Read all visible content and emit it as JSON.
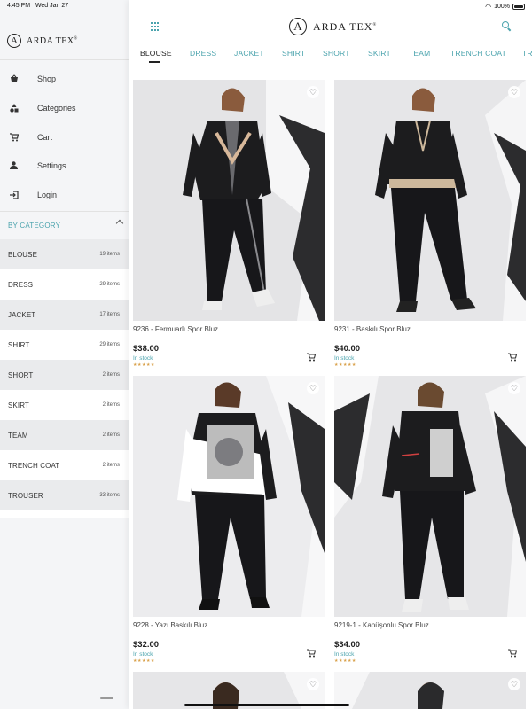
{
  "status_bar": {
    "time": "4:45 PM",
    "date": "Wed Jan 27",
    "battery": "100%"
  },
  "brand": {
    "letter": "A",
    "name": "ARDA TEX",
    "reg": "®"
  },
  "sidebar": {
    "nav": [
      {
        "label": "Shop",
        "icon": "basket-icon"
      },
      {
        "label": "Categories",
        "icon": "shapes-icon"
      },
      {
        "label": "Cart",
        "icon": "cart-icon"
      },
      {
        "label": "Settings",
        "icon": "person-icon"
      },
      {
        "label": "Login",
        "icon": "login-icon"
      }
    ],
    "category_header": "BY CATEGORY",
    "categories": [
      {
        "name": "BLOUSE",
        "count": "19 items"
      },
      {
        "name": "DRESS",
        "count": "29 items"
      },
      {
        "name": "JACKET",
        "count": "17 items"
      },
      {
        "name": "SHIRT",
        "count": "29 items"
      },
      {
        "name": "SHORT",
        "count": "2 items"
      },
      {
        "name": "SKIRT",
        "count": "2 items"
      },
      {
        "name": "TEAM",
        "count": "2 items"
      },
      {
        "name": "TRENCH COAT",
        "count": "2 items"
      },
      {
        "name": "TROUSER",
        "count": "33 items"
      }
    ]
  },
  "tabs": [
    "BLOUSE",
    "DRESS",
    "JACKET",
    "SHIRT",
    "SHORT",
    "SKIRT",
    "TEAM",
    "TRENCH COAT",
    "TR"
  ],
  "active_tab": "BLOUSE",
  "products": [
    {
      "name": "9236 - Fermuarlı Spor Bluz",
      "price": "$38.00",
      "stock": "In stock",
      "stars": "★★★★★"
    },
    {
      "name": "9231 - Baskılı Spor Bluz",
      "price": "$40.00",
      "stock": "In stock",
      "stars": "★★★★★"
    },
    {
      "name": "9228 - Yazı Baskılı Bluz",
      "price": "$32.00",
      "stock": "In stock",
      "stars": "★★★★★"
    },
    {
      "name": "9219-1 - Kapüşonlu Spor Bluz",
      "price": "$34.00",
      "stock": "In stock",
      "stars": "★★★★★"
    }
  ],
  "colors": {
    "accent": "#4aa3ad",
    "sidebar_bg": "#f4f5f7",
    "text": "#333333"
  }
}
